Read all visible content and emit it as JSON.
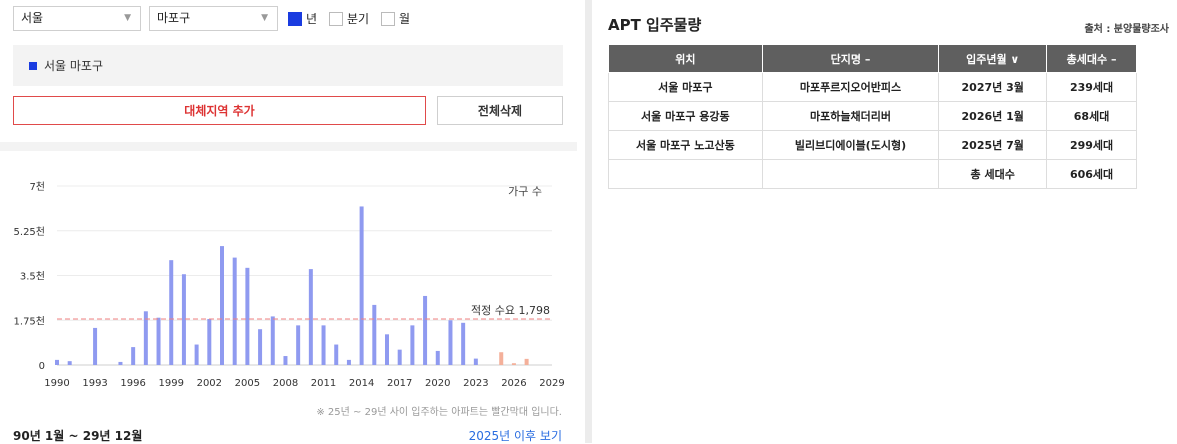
{
  "filters": {
    "city": "서울",
    "district": "마포구",
    "period_options": [
      {
        "label": "년",
        "checked": true
      },
      {
        "label": "분기",
        "checked": false
      },
      {
        "label": "월",
        "checked": false
      }
    ]
  },
  "region_panel": {
    "item": "서울 마포구"
  },
  "buttons": {
    "add_region": "대체지역 추가",
    "delete_all": "전체삭제"
  },
  "colors": {
    "bar": "#8f9af0",
    "future_bar": "#f4b09a",
    "threshold": "#f08080",
    "accent": "#1a3ce0"
  },
  "chart_data": {
    "type": "bar",
    "series_label": "가구 수",
    "y_ticks": [
      {
        "value": 0,
        "label": "0"
      },
      {
        "value": 1750,
        "label": "1.75천"
      },
      {
        "value": 3500,
        "label": "3.5천"
      },
      {
        "value": 5250,
        "label": "5.25천"
      },
      {
        "value": 7000,
        "label": "7천"
      }
    ],
    "ylim": [
      0,
      7000
    ],
    "xlim": [
      1990,
      2029
    ],
    "x_ticks": [
      1990,
      1993,
      1996,
      1999,
      2002,
      2005,
      2008,
      2011,
      2014,
      2017,
      2020,
      2023,
      2026,
      2029
    ],
    "bars": [
      {
        "year": 1990,
        "value": 200
      },
      {
        "year": 1991,
        "value": 150
      },
      {
        "year": 1993,
        "value": 1450
      },
      {
        "year": 1995,
        "value": 120
      },
      {
        "year": 1996,
        "value": 700
      },
      {
        "year": 1997,
        "value": 2100
      },
      {
        "year": 1998,
        "value": 1850
      },
      {
        "year": 1999,
        "value": 4100
      },
      {
        "year": 2000,
        "value": 3550
      },
      {
        "year": 2001,
        "value": 800
      },
      {
        "year": 2002,
        "value": 1800
      },
      {
        "year": 2003,
        "value": 4650
      },
      {
        "year": 2004,
        "value": 4200
      },
      {
        "year": 2005,
        "value": 3800
      },
      {
        "year": 2006,
        "value": 1400
      },
      {
        "year": 2007,
        "value": 1900
      },
      {
        "year": 2008,
        "value": 350
      },
      {
        "year": 2009,
        "value": 1550
      },
      {
        "year": 2010,
        "value": 3750
      },
      {
        "year": 2011,
        "value": 1550
      },
      {
        "year": 2012,
        "value": 800
      },
      {
        "year": 2013,
        "value": 200
      },
      {
        "year": 2014,
        "value": 6200
      },
      {
        "year": 2015,
        "value": 2350
      },
      {
        "year": 2016,
        "value": 1200
      },
      {
        "year": 2017,
        "value": 600
      },
      {
        "year": 2018,
        "value": 1550
      },
      {
        "year": 2019,
        "value": 2700
      },
      {
        "year": 2020,
        "value": 550
      },
      {
        "year": 2021,
        "value": 1750
      },
      {
        "year": 2022,
        "value": 1650
      },
      {
        "year": 2023,
        "value": 250
      },
      {
        "year": 2025,
        "value": 500,
        "future": true
      },
      {
        "year": 2026,
        "value": 70,
        "future": true
      },
      {
        "year": 2027,
        "value": 240,
        "future": true
      }
    ],
    "threshold": {
      "value": 1798,
      "label": "적정 수요 1,798"
    }
  },
  "note": "※ 25년 ~ 29년 사이 입주하는 아파트는 빨간막대 입니다.",
  "period_label": "90년 1월 ~ 29년 12월",
  "more_link": "2025년 이후 보기",
  "right": {
    "title": "APT 입주물량",
    "source": "출처 : 분양물량조사",
    "columns": [
      "위치",
      "단지명 –",
      "입주년월 ∨",
      "총세대수 –"
    ],
    "rows": [
      [
        "서울 마포구",
        "마포푸르지오어반피스",
        "2027년 3월",
        "239세대"
      ],
      [
        "서울 마포구 용강동",
        "마포하늘채더리버",
        "2026년 1월",
        "68세대"
      ],
      [
        "서울 마포구 노고산동",
        "빌리브디에이블(도시형)",
        "2025년 7월",
        "299세대"
      ],
      [
        "",
        "",
        "총 세대수",
        "606세대"
      ]
    ]
  }
}
